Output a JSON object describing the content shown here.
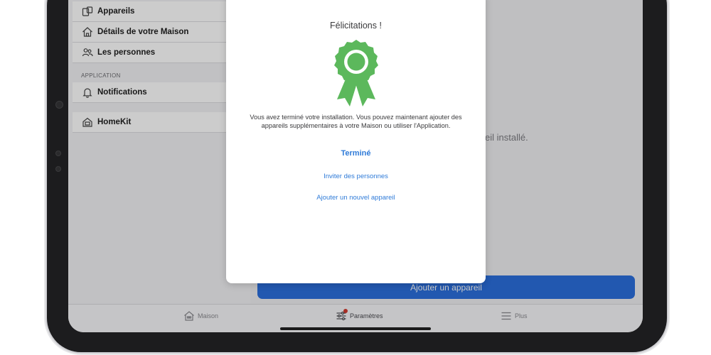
{
  "sidebar": {
    "items": [
      {
        "label": "Appareils",
        "icon": "devices-icon"
      },
      {
        "label": "Détails de votre Maison",
        "icon": "house-icon"
      },
      {
        "label": "Les personnes",
        "icon": "people-icon"
      }
    ],
    "section_label": "APPLICATION",
    "notifications_label": "Notifications",
    "homekit_label": "HomeKit"
  },
  "content": {
    "status_fragment": "eil installé.",
    "add_device_label": "Ajouter un appareil"
  },
  "tabbar": {
    "tabs": [
      {
        "label": "Maison",
        "icon": "home-tab-icon"
      },
      {
        "label": "Paramètres",
        "icon": "settings-sliders-icon",
        "badge": true
      },
      {
        "label": "Plus",
        "icon": "menu-icon"
      }
    ]
  },
  "modal": {
    "title": "Félicitations !",
    "message": "Vous avez terminé votre installation. Vous pouvez maintenant ajouter des appareils supplémentaires à votre Maison ou utiliser l'Application.",
    "done_label": "Terminé",
    "invite_label": "Inviter des personnes",
    "add_device_label": "Ajouter un nouvel appareil",
    "medal_color": "#5cb85c"
  },
  "colors": {
    "accent": "#2f7bd8",
    "primary_button": "#2b6fdc",
    "badge": "#d33a2f"
  }
}
